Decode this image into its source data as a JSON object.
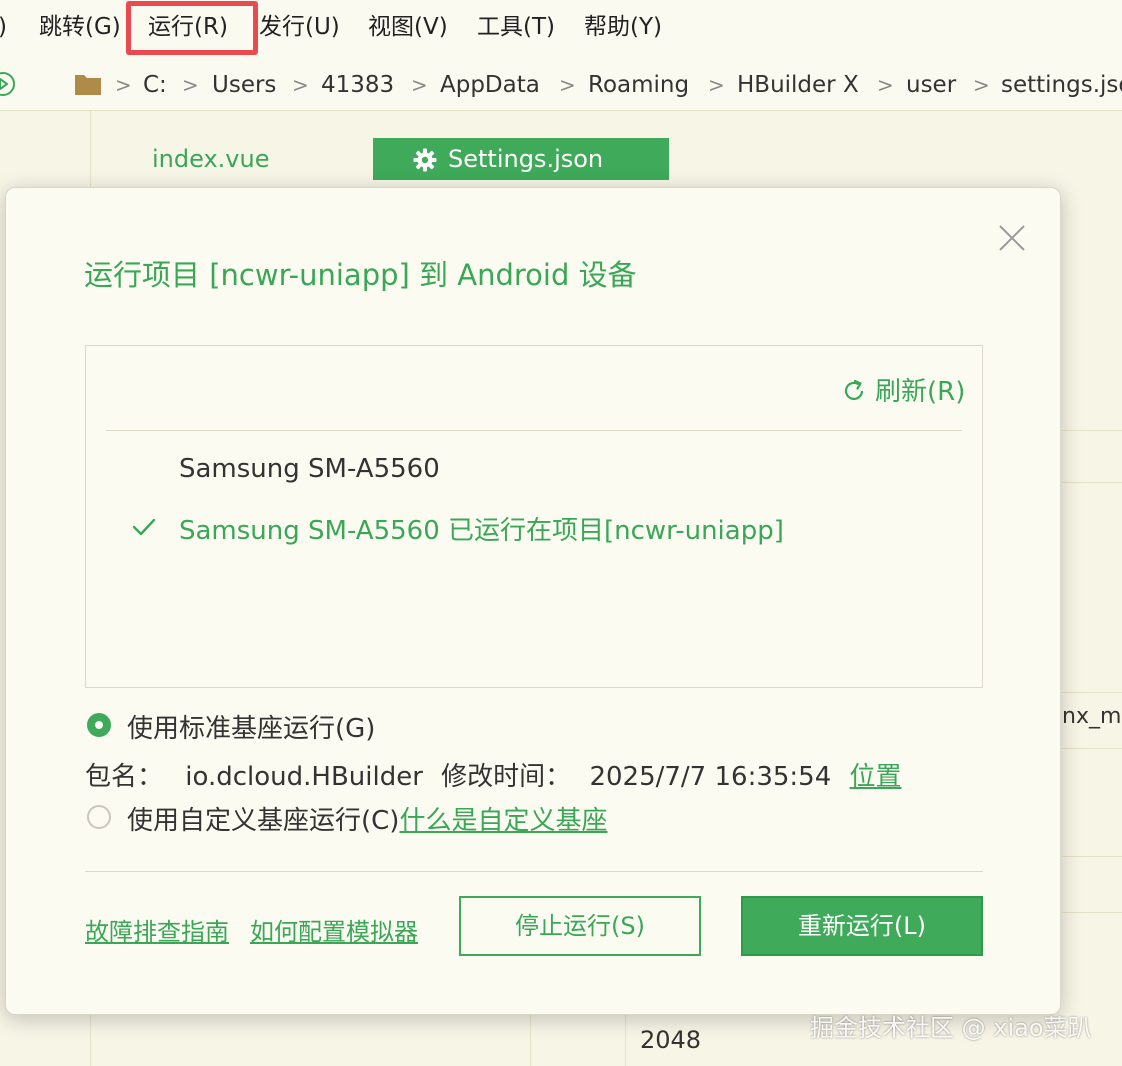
{
  "menubar": {
    "items": [
      {
        "label": ")"
      },
      {
        "label": "跳转(G)"
      },
      {
        "label": "运行(R)"
      },
      {
        "label": "发行(U)"
      },
      {
        "label": "视图(V)"
      },
      {
        "label": "工具(T)"
      },
      {
        "label": "帮助(Y)"
      }
    ],
    "highlight_color": "#e84a4f"
  },
  "breadcrumb": {
    "items": [
      "C:",
      "Users",
      "41383",
      "AppData",
      "Roaming",
      "HBuilder X",
      "user",
      "settings.json"
    ],
    "separator": ">"
  },
  "editor": {
    "tabs": [
      {
        "label": "index.vue",
        "active": false
      },
      {
        "label": "Settings.json",
        "active": true,
        "icon": "gear-icon"
      }
    ],
    "background_fragments": {
      "right_text": "nx_m",
      "bottom_value": "2048"
    }
  },
  "dialog": {
    "title": "运行项目 [ncwr-uniapp] 到 Android 设备",
    "refresh_label": "刷新(R)",
    "devices": [
      {
        "name": "Samsung SM-A5560"
      },
      {
        "status": "Samsung SM-A5560 已运行在项目[ncwr-uniapp]",
        "checked": true
      }
    ],
    "options": {
      "standard_label": "使用标准基座运行(G)",
      "standard_selected": true,
      "custom_label": "使用自定义基座运行(C)",
      "custom_selected": false,
      "custom_help_link": "什么是自定义基座"
    },
    "package": {
      "name_label": "包名：",
      "name_value": "io.dcloud.HBuilder",
      "time_label": "修改时间：",
      "time_value": "2025/7/7 16:35:54",
      "location_link": "位置"
    },
    "footer": {
      "link_troubleshoot": "故障排查指南",
      "link_emulator": "如何配置模拟器",
      "stop_button": "停止运行(S)",
      "rerun_button": "重新运行(L)"
    },
    "accent_color": "#3eaa5a"
  },
  "watermark": "掘金技术社区 @ xiao菜趴"
}
